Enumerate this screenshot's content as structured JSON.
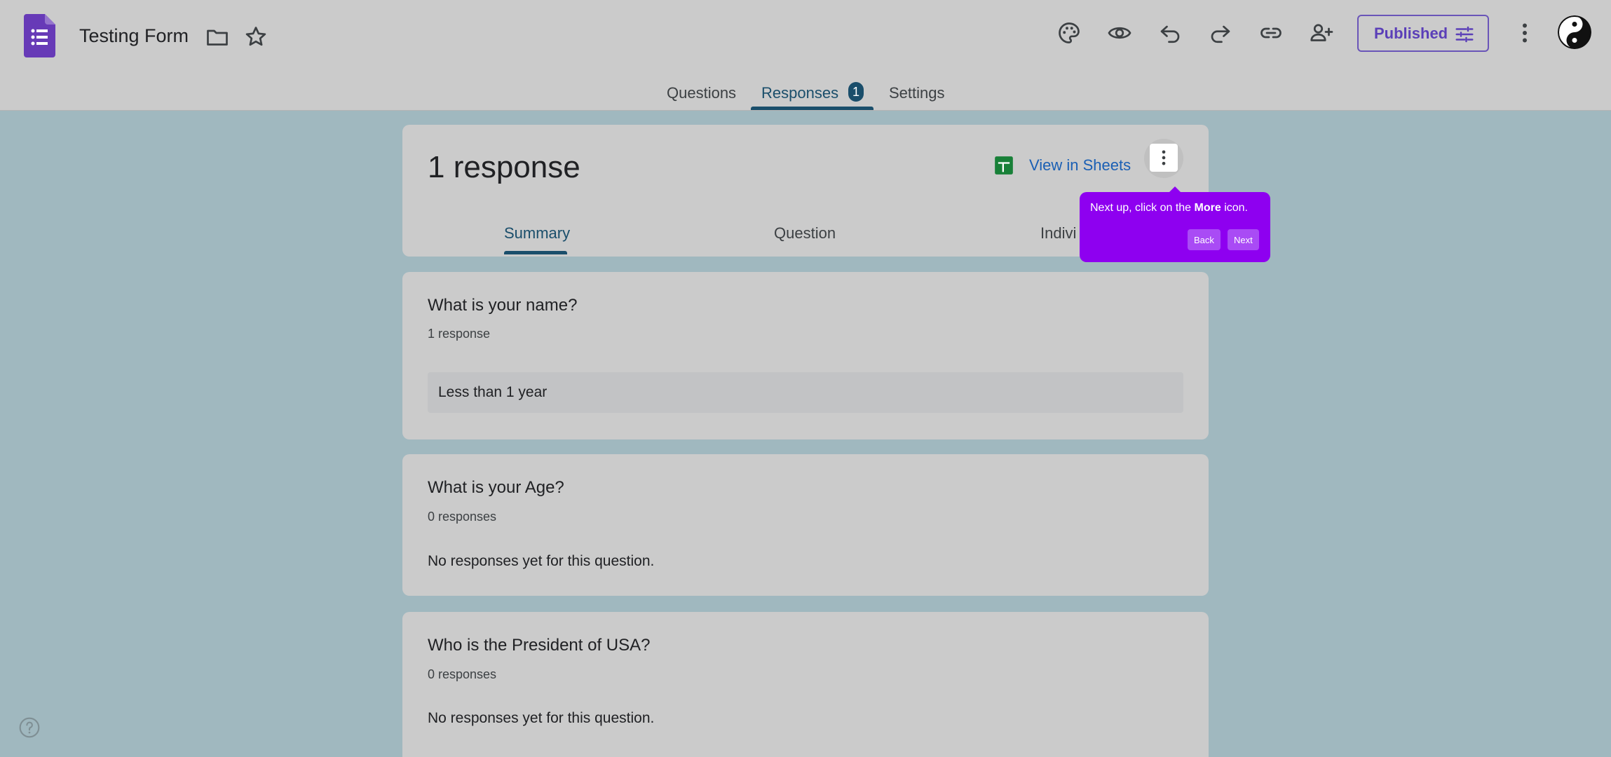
{
  "header": {
    "title": "Testing Form",
    "publish_label": "Published",
    "colors": {
      "app_icon": "#673ab7",
      "accent": "#1a4e6b",
      "publish": "#5b3fb8"
    }
  },
  "tabs": {
    "questions": "Questions",
    "responses": "Responses",
    "responses_badge": "1",
    "settings": "Settings"
  },
  "summary_card": {
    "count": "1 response",
    "view_in_sheets": "View in Sheets",
    "sub_tabs": {
      "summary": "Summary",
      "question": "Question",
      "individual": "Indivi"
    }
  },
  "tooltip": {
    "text_before": "Next up, click on the ",
    "text_bold": "More",
    "text_after": " icon.",
    "back": "Back",
    "next": "Next",
    "color": "#8e00f0"
  },
  "questions": [
    {
      "title": "What is your name?",
      "count": "1 response",
      "answer": "Less than 1 year"
    },
    {
      "title": "What is your Age?",
      "count": "0 responses",
      "empty": "No responses yet for this question."
    },
    {
      "title": "Who is the President of USA?",
      "count": "0 responses",
      "empty": "No responses yet for this question."
    }
  ]
}
